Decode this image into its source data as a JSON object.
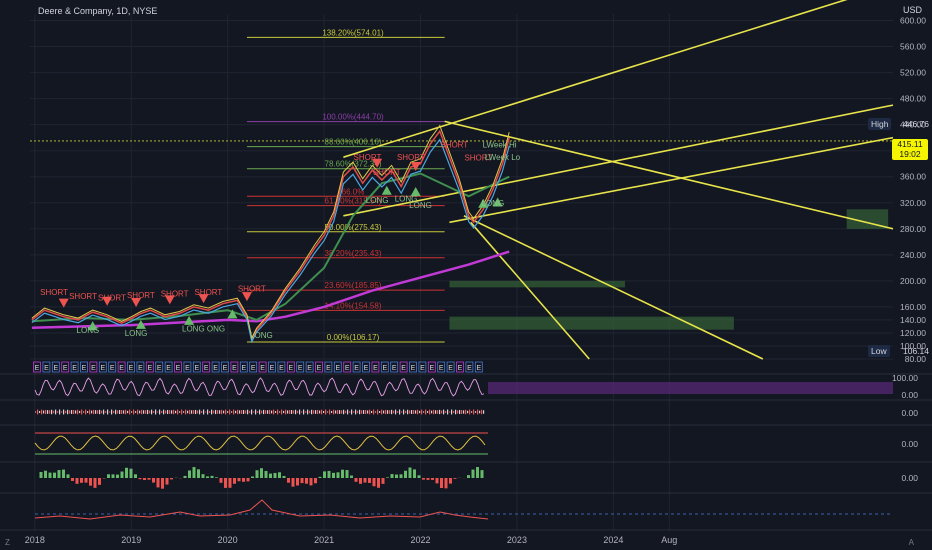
{
  "header": {
    "title": "Deere & Company, 1D, NYSE",
    "currency": "USD"
  },
  "sidebar": {
    "left_label": "Z",
    "right_label": "A"
  },
  "price_tags": {
    "high_label": "High",
    "high_value": "446.76",
    "low_label": "Low",
    "low_value": "106.14",
    "last_price": "415.11",
    "countdown": "19:02"
  },
  "chart_data": {
    "type": "line",
    "main_axis": {
      "ylim": [
        60,
        610
      ],
      "ticks": [
        80,
        100,
        120,
        140,
        160,
        200,
        240,
        280,
        320,
        360,
        400,
        440,
        480,
        520,
        560,
        600
      ],
      "tick_labels": [
        "80.00",
        "100.00",
        "120.00",
        "140.00",
        "160.00",
        "200.00",
        "240.00",
        "280.00",
        "320.00",
        "360.00",
        "400.00",
        "440.00",
        "480.00",
        "520.00",
        "560.00",
        "600.00"
      ]
    },
    "x_axis": {
      "labels": [
        "2018",
        "2019",
        "2020",
        "2021",
        "2022",
        "2023",
        "2024",
        "Aug"
      ],
      "positions": [
        2018.0,
        2019.0,
        2020.0,
        2021.0,
        2022.0,
        2023.0,
        2024.0,
        2024.58
      ],
      "xlim": [
        2017.95,
        2026.9
      ]
    },
    "price_series": {
      "name": "Price",
      "x": [
        2017.97,
        2018.1,
        2018.2,
        2018.3,
        2018.45,
        2018.6,
        2018.75,
        2018.9,
        2019.0,
        2019.1,
        2019.2,
        2019.35,
        2019.5,
        2019.65,
        2019.8,
        2019.95,
        2020.1,
        2020.2,
        2020.25,
        2020.3,
        2020.45,
        2020.6,
        2020.75,
        2020.9,
        2021.0,
        2021.1,
        2021.2,
        2021.3,
        2021.4,
        2021.5,
        2021.6,
        2021.7,
        2021.8,
        2021.9,
        2022.0,
        2022.1,
        2022.2,
        2022.3,
        2022.4,
        2022.5,
        2022.55,
        2022.65,
        2022.75,
        2022.85,
        2022.92
      ],
      "y": [
        140,
        155,
        150,
        145,
        140,
        152,
        145,
        135,
        142,
        150,
        155,
        145,
        150,
        160,
        155,
        165,
        170,
        145,
        110,
        125,
        150,
        185,
        215,
        250,
        270,
        300,
        360,
        375,
        350,
        370,
        355,
        370,
        345,
        375,
        380,
        410,
        430,
        390,
        350,
        300,
        290,
        310,
        340,
        380,
        420
      ]
    },
    "ma_series": [
      {
        "x": [
          2017.97,
          2018.5,
          2019.0,
          2019.5,
          2020.0,
          2020.3,
          2020.6,
          2021.0,
          2021.5,
          2022.0,
          2022.5,
          2022.92
        ],
        "y": [
          128,
          130,
          132,
          136,
          140,
          138,
          145,
          160,
          185,
          205,
          225,
          245
        ]
      },
      {
        "x": [
          2017.97,
          2018.5,
          2019.0,
          2019.5,
          2020.0,
          2020.3,
          2020.6,
          2021.0,
          2021.3,
          2021.6,
          2022.0,
          2022.5,
          2022.92
        ],
        "y": [
          138,
          143,
          140,
          146,
          155,
          140,
          165,
          220,
          300,
          350,
          365,
          330,
          360
        ]
      }
    ],
    "fib_levels": [
      {
        "label": "138.20%(574.01)",
        "value": 574.01
      },
      {
        "label": "100.00%(444.70)",
        "value": 444.7
      },
      {
        "label": "88.60%(406.16)",
        "value": 406.16
      },
      {
        "label": "78.60%(372.34)",
        "value": 372.34
      },
      {
        "label": "66.0%",
        "value": 330
      },
      {
        "label": "61.80%(315.54)",
        "value": 315.54
      },
      {
        "label": "50.00%(275.43)",
        "value": 275.43
      },
      {
        "label": "38.20%(235.43)",
        "value": 235.43
      },
      {
        "label": "23.60%(185.85)",
        "value": 185.85
      },
      {
        "label": "14.10%(154.58)",
        "value": 154.58
      },
      {
        "label": "0.00%(106.17)",
        "value": 106.17
      }
    ],
    "zones": [
      {
        "x1": 2022.3,
        "x2": 2024.12,
        "y1": 190,
        "y2": 200
      },
      {
        "x1": 2022.3,
        "x2": 2025.25,
        "y1": 125,
        "y2": 145
      },
      {
        "x1": 2026.42,
        "x2": 2026.85,
        "y1": 280,
        "y2": 310
      }
    ],
    "trend_lines": [
      {
        "x1": 2021.2,
        "x2": 2026.8,
        "y1": 390,
        "y2": 650
      },
      {
        "x1": 2021.2,
        "x2": 2026.9,
        "y1": 300,
        "y2": 470
      },
      {
        "x1": 2022.3,
        "x2": 2026.9,
        "y1": 290,
        "y2": 420
      },
      {
        "x1": 2022.25,
        "x2": 2026.9,
        "y1": 445,
        "y2": 280
      },
      {
        "x1": 2022.45,
        "x2": 2025.55,
        "y1": 300,
        "y2": 80
      },
      {
        "x1": 2022.52,
        "x2": 2023.75,
        "y1": 290,
        "y2": 80
      }
    ],
    "signal_labels": [
      {
        "text": "SHORT",
        "x": 2018.2,
        "y": 178
      },
      {
        "text": "SHORT",
        "x": 2018.5,
        "y": 172
      },
      {
        "text": "SHORT",
        "x": 2018.8,
        "y": 170
      },
      {
        "text": "SHORT",
        "x": 2019.1,
        "y": 174
      },
      {
        "text": "SHORT",
        "x": 2019.45,
        "y": 176
      },
      {
        "text": "SHORT",
        "x": 2019.8,
        "y": 178
      },
      {
        "text": "SHORT",
        "x": 2020.25,
        "y": 184
      },
      {
        "text": "SHORT",
        "x": 2021.45,
        "y": 386
      },
      {
        "text": "SHORT",
        "x": 2021.65,
        "y": 363
      },
      {
        "text": "SHORT",
        "x": 2021.9,
        "y": 386
      },
      {
        "text": "SHORT",
        "x": 2022.35,
        "y": 405
      },
      {
        "text": "SHORT",
        "x": 2022.6,
        "y": 385
      },
      {
        "text": "LONG",
        "x": 2018.55,
        "y": 120
      },
      {
        "text": "LONG",
        "x": 2019.05,
        "y": 115
      },
      {
        "text": "LONG ONG",
        "x": 2019.75,
        "y": 122
      },
      {
        "text": "LONG",
        "x": 2020.35,
        "y": 112
      },
      {
        "text": "LONG",
        "x": 2021.55,
        "y": 320
      },
      {
        "text": "LONG",
        "x": 2021.85,
        "y": 322
      },
      {
        "text": "LONG",
        "x": 2022.0,
        "y": 312
      },
      {
        "text": "LWeek Hi",
        "x": 2022.82,
        "y": 405
      },
      {
        "text": "LWeek Lo",
        "x": 2022.85,
        "y": 386
      },
      {
        "text": "LONG",
        "x": 2022.75,
        "y": 315
      }
    ],
    "markers_down": [
      {
        "x": 2018.3,
        "y": 165
      },
      {
        "x": 2018.75,
        "y": 168
      },
      {
        "x": 2019.05,
        "y": 166
      },
      {
        "x": 2019.4,
        "y": 170
      },
      {
        "x": 2019.75,
        "y": 172
      },
      {
        "x": 2020.2,
        "y": 175
      },
      {
        "x": 2021.55,
        "y": 380
      },
      {
        "x": 2021.95,
        "y": 375
      }
    ],
    "markers_up": [
      {
        "x": 2018.6,
        "y": 132
      },
      {
        "x": 2019.1,
        "y": 134
      },
      {
        "x": 2019.6,
        "y": 140
      },
      {
        "x": 2020.05,
        "y": 150
      },
      {
        "x": 2021.65,
        "y": 340
      },
      {
        "x": 2021.95,
        "y": 338
      },
      {
        "x": 2022.65,
        "y": 320
      },
      {
        "x": 2022.8,
        "y": 322
      }
    ],
    "oscillator_panel": {
      "tick_labels": [
        "100.00",
        "0.00"
      ]
    },
    "panel_2": {
      "tick_labels": [
        "0.00"
      ]
    },
    "panel_3": {
      "tick_labels": [
        "0.00"
      ]
    },
    "panel_4": {
      "tick_labels": [
        "0.00"
      ]
    },
    "volume_markers": "E"
  }
}
